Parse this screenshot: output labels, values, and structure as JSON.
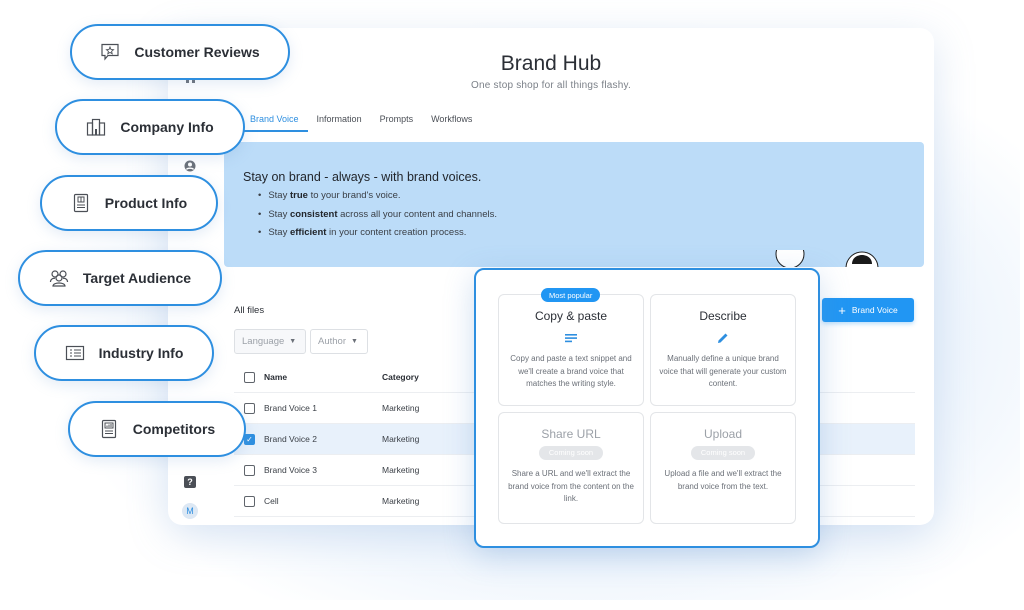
{
  "header": {
    "title": "Brand Hub",
    "subtitle": "One stop shop for all things flashy."
  },
  "tabs": [
    {
      "label": "Brand Voice",
      "active": true
    },
    {
      "label": "Information",
      "active": false
    },
    {
      "label": "Prompts",
      "active": false
    },
    {
      "label": "Workflows",
      "active": false
    }
  ],
  "banner": {
    "heading": "Stay on brand - always - with brand voices.",
    "bullets": [
      {
        "prefix": "Stay ",
        "bold": "true",
        "suffix": " to your brand's voice."
      },
      {
        "prefix": "Stay ",
        "bold": "consistent",
        "suffix": " across all your content and channels."
      },
      {
        "prefix": "Stay ",
        "bold": "efficient",
        "suffix": " in your content creation process."
      }
    ]
  },
  "files": {
    "section_label": "All files",
    "filters": [
      {
        "label": "Language",
        "caret": "▼"
      },
      {
        "label": "Author",
        "caret": "▼"
      }
    ],
    "columns": [
      "Name",
      "Category"
    ],
    "rows": [
      {
        "name": "Brand Voice 1",
        "category": "Marketing",
        "checked": false
      },
      {
        "name": "Brand Voice 2",
        "category": "Marketing",
        "checked": true
      },
      {
        "name": "Brand Voice 3",
        "category": "Marketing",
        "checked": false
      },
      {
        "name": "Cell",
        "category": "Marketing",
        "checked": false
      }
    ]
  },
  "add_button": {
    "icon": "+",
    "label": "Brand Voice"
  },
  "rail": {
    "help": "?",
    "avatar": "M"
  },
  "pills": [
    {
      "label": "Customer Reviews",
      "icon": "star-speech-bubble-icon"
    },
    {
      "label": "Company Info",
      "icon": "building-icon"
    },
    {
      "label": "Product Info",
      "icon": "product-box-icon"
    },
    {
      "label": "Target Audience",
      "icon": "people-group-icon"
    },
    {
      "label": "Industry Info",
      "icon": "industry-list-icon"
    },
    {
      "label": "Competitors",
      "icon": "chart-document-icon"
    }
  ],
  "modal": {
    "options": [
      {
        "title": "Copy & paste",
        "badge": "Most popular",
        "icon": "text-lines-icon",
        "description": "Copy and paste a text snippet and we'll create a brand voice that matches the writing style."
      },
      {
        "title": "Describe",
        "icon": "pencil-icon",
        "description": "Manually define a unique brand voice that will generate your custom content."
      },
      {
        "title": "Share URL",
        "badge": "Coming soon",
        "description": "Share a URL and we'll extract the brand voice from the content on the link."
      },
      {
        "title": "Upload",
        "badge": "Coming soon",
        "description": "Upload a file and we'll extract the brand voice from the text."
      }
    ]
  },
  "colors": {
    "accent": "#2e8fe0",
    "button": "#2196f3",
    "banner": "#bcdcf8",
    "selected_row": "#e8f1fb"
  }
}
